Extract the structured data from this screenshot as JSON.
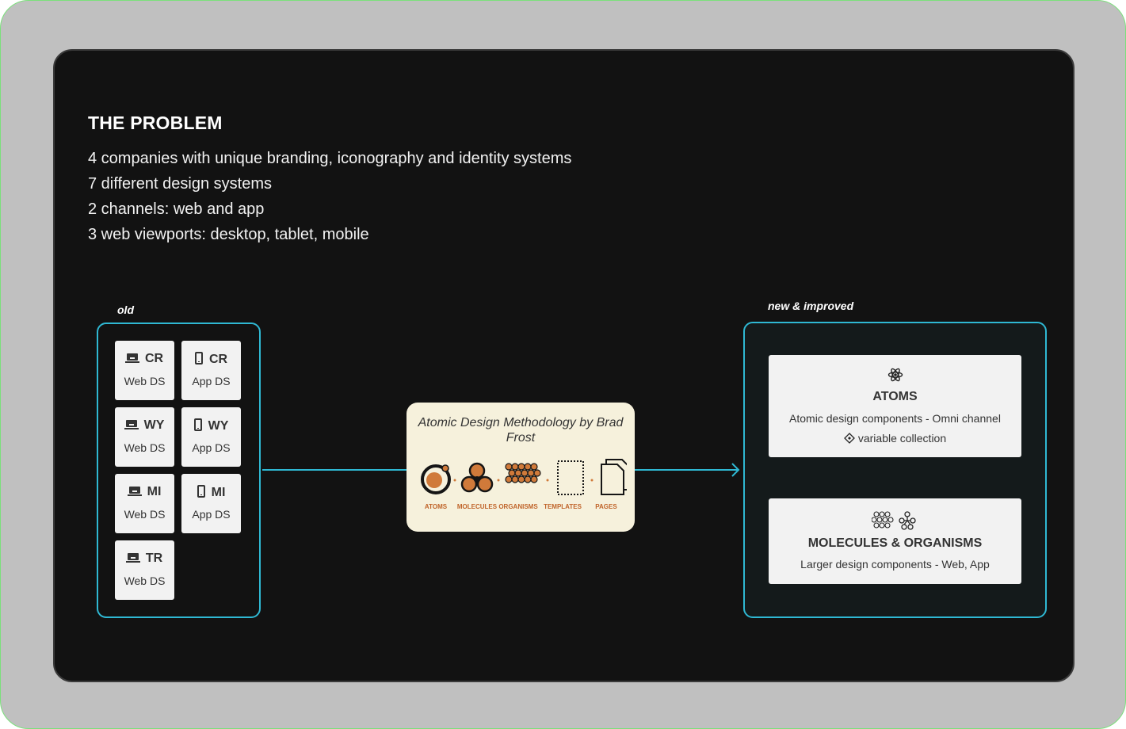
{
  "problem": {
    "title": "THE PROBLEM",
    "lines": [
      "4 companies with unique branding, iconography and identity systems",
      "7 different design systems",
      "2 channels: web and app",
      "3 web viewports: desktop, tablet, mobile"
    ]
  },
  "old": {
    "caption": "old",
    "tiles": [
      {
        "code": "CR",
        "label": "Web DS",
        "icon": "laptop-icon"
      },
      {
        "code": "CR",
        "label": "App DS",
        "icon": "phone-icon"
      },
      {
        "code": "WY",
        "label": "Web DS",
        "icon": "laptop-icon"
      },
      {
        "code": "WY",
        "label": "App DS",
        "icon": "phone-icon"
      },
      {
        "code": "MI",
        "label": "Web DS",
        "icon": "laptop-icon"
      },
      {
        "code": "MI",
        "label": "App DS",
        "icon": "phone-icon"
      },
      {
        "code": "TR",
        "label": "Web DS",
        "icon": "laptop-icon"
      }
    ]
  },
  "methodology": {
    "title": "Atomic Design Methodology by Brad Frost",
    "stages": [
      "ATOMS",
      "MOLECULES",
      "ORGANISMS",
      "TEMPLATES",
      "PAGES"
    ],
    "accent": "#d07a3a"
  },
  "new": {
    "caption": "new & improved",
    "atoms": {
      "title": "ATOMS",
      "desc": "Atomic design components - Omni channel",
      "sub": "variable collection"
    },
    "molecules": {
      "title": "MOLECULES & ORGANISMS",
      "desc": "Larger design components - Web, App"
    }
  },
  "colors": {
    "connector": "#2fb8d3",
    "card": "#121212"
  }
}
